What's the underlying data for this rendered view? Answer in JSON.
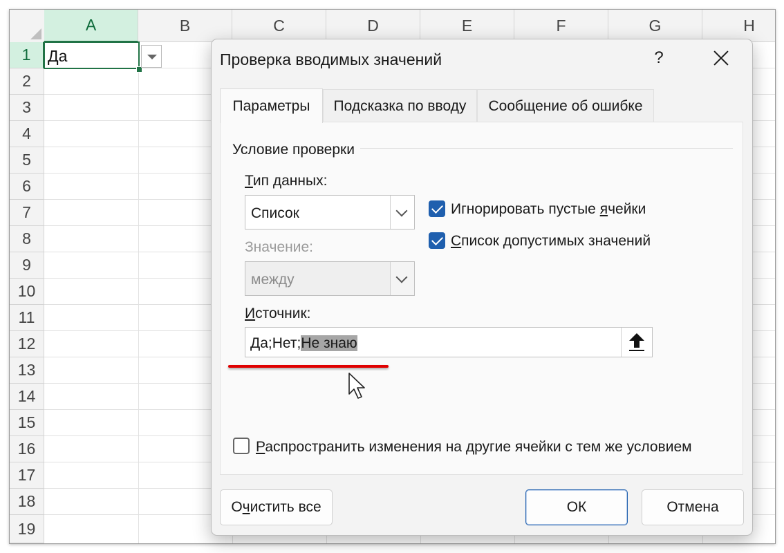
{
  "spreadsheet": {
    "columns": [
      "A",
      "B",
      "C",
      "D",
      "E",
      "F",
      "G",
      "H"
    ],
    "rows": [
      "1",
      "2",
      "3",
      "4",
      "5",
      "6",
      "7",
      "8",
      "9",
      "10",
      "11",
      "12",
      "13",
      "14",
      "15",
      "16",
      "17",
      "18",
      "19"
    ],
    "active_cell_value": "Да"
  },
  "dialog": {
    "title": "Проверка вводимых значений",
    "help": "?",
    "tabs": [
      "Параметры",
      "Подсказка по вводу",
      "Сообщение об ошибке"
    ],
    "group_label": "Условие проверки",
    "data_type": {
      "label_first": "Т",
      "label_rest": "ип данных:",
      "value": "Список"
    },
    "value": {
      "label": "Значение:",
      "value": "между"
    },
    "ignore_blank": {
      "label_before": "Игнорировать пустые ",
      "label_underlined": "я",
      "label_after": "чейки",
      "checked": true
    },
    "in_cell_dropdown": {
      "label_first": "С",
      "label_rest": "писок допустимых значений",
      "checked": true
    },
    "source": {
      "label_first": "И",
      "label_rest": "сточник:",
      "value_plain": "Да;Нет;",
      "value_selected": "Не знаю"
    },
    "apply_all": {
      "label_first": "Р",
      "label_rest": "аспространить изменения на другие ячейки с тем же условием",
      "checked": false
    },
    "buttons": {
      "clear_all_before": "О",
      "clear_all_underlined": "ч",
      "clear_all_after": "истить все",
      "ok": "ОК",
      "cancel": "Отмена"
    }
  },
  "colors": {
    "excel_green": "#217346",
    "checkbox_blue": "#1f5fae",
    "annotation_red": "#e00000"
  }
}
